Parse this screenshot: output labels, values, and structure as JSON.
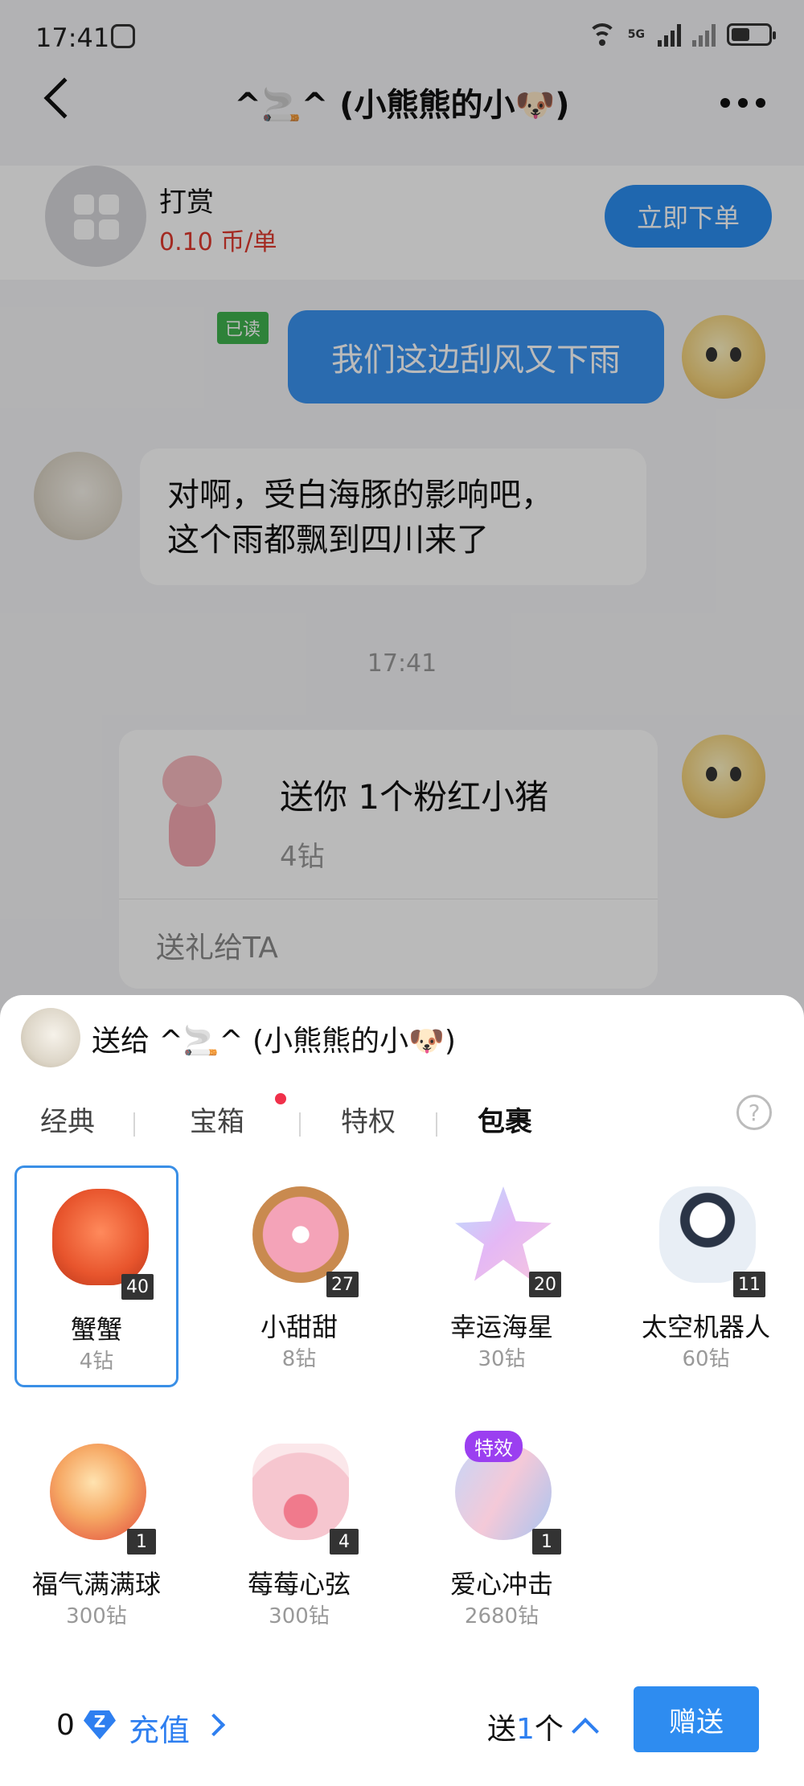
{
  "status": {
    "time": "17:41"
  },
  "header": {
    "title": "^🚬^ (小熊熊的小🐶)"
  },
  "order": {
    "name": "打赏",
    "price": "0.10 币/单",
    "button": "立即下单"
  },
  "messages": {
    "read_tag": "已读",
    "outgoing_text": "我们这边刮风又下雨",
    "incoming_line1": "对啊，受白海豚的影响吧，",
    "incoming_line2": "这个雨都飘到四川来了",
    "time": "17:41"
  },
  "gift_card": {
    "title": "送你 1个粉红小猪",
    "price": "4钻",
    "action": "送礼给TA"
  },
  "sheet": {
    "send_to": "送给 ^🚬^ (小熊熊的小🐶)",
    "tabs": [
      {
        "label": "经典"
      },
      {
        "label": "宝箱"
      },
      {
        "label": "特权"
      },
      {
        "label": "包裹"
      }
    ],
    "help": "?",
    "items": [
      {
        "name": "蟹蟹",
        "price": "4钻",
        "count": "40",
        "color": "#e8552d",
        "icon": "crab-icon"
      },
      {
        "name": "小甜甜",
        "price": "8钻",
        "count": "27",
        "color": "#f4a3b8",
        "icon": "donut-icon"
      },
      {
        "name": "幸运海星",
        "price": "30钻",
        "count": "20",
        "color": "#c9a6f0",
        "icon": "starfish-icon"
      },
      {
        "name": "太空机器人",
        "price": "60钻",
        "count": "11",
        "color": "#cfe3f5",
        "icon": "robot-icon"
      },
      {
        "name": "福气满满球",
        "price": "300钻",
        "count": "1",
        "color": "#f08a5a",
        "icon": "lucky-ball-icon"
      },
      {
        "name": "莓莓心弦",
        "price": "300钻",
        "count": "4",
        "color": "#f6c6cf",
        "icon": "harp-icon"
      },
      {
        "name": "爱心冲击",
        "price": "2680钻",
        "count": "1",
        "color": "#b9c8f2",
        "icon": "heart-impact-icon",
        "tag": "特效"
      }
    ],
    "footer": {
      "balance": "0",
      "diamond_glyph": "Z",
      "recharge": "充值",
      "qty_prefix": "送",
      "qty_num": "1",
      "qty_suffix": "个",
      "send": "赠送"
    }
  }
}
